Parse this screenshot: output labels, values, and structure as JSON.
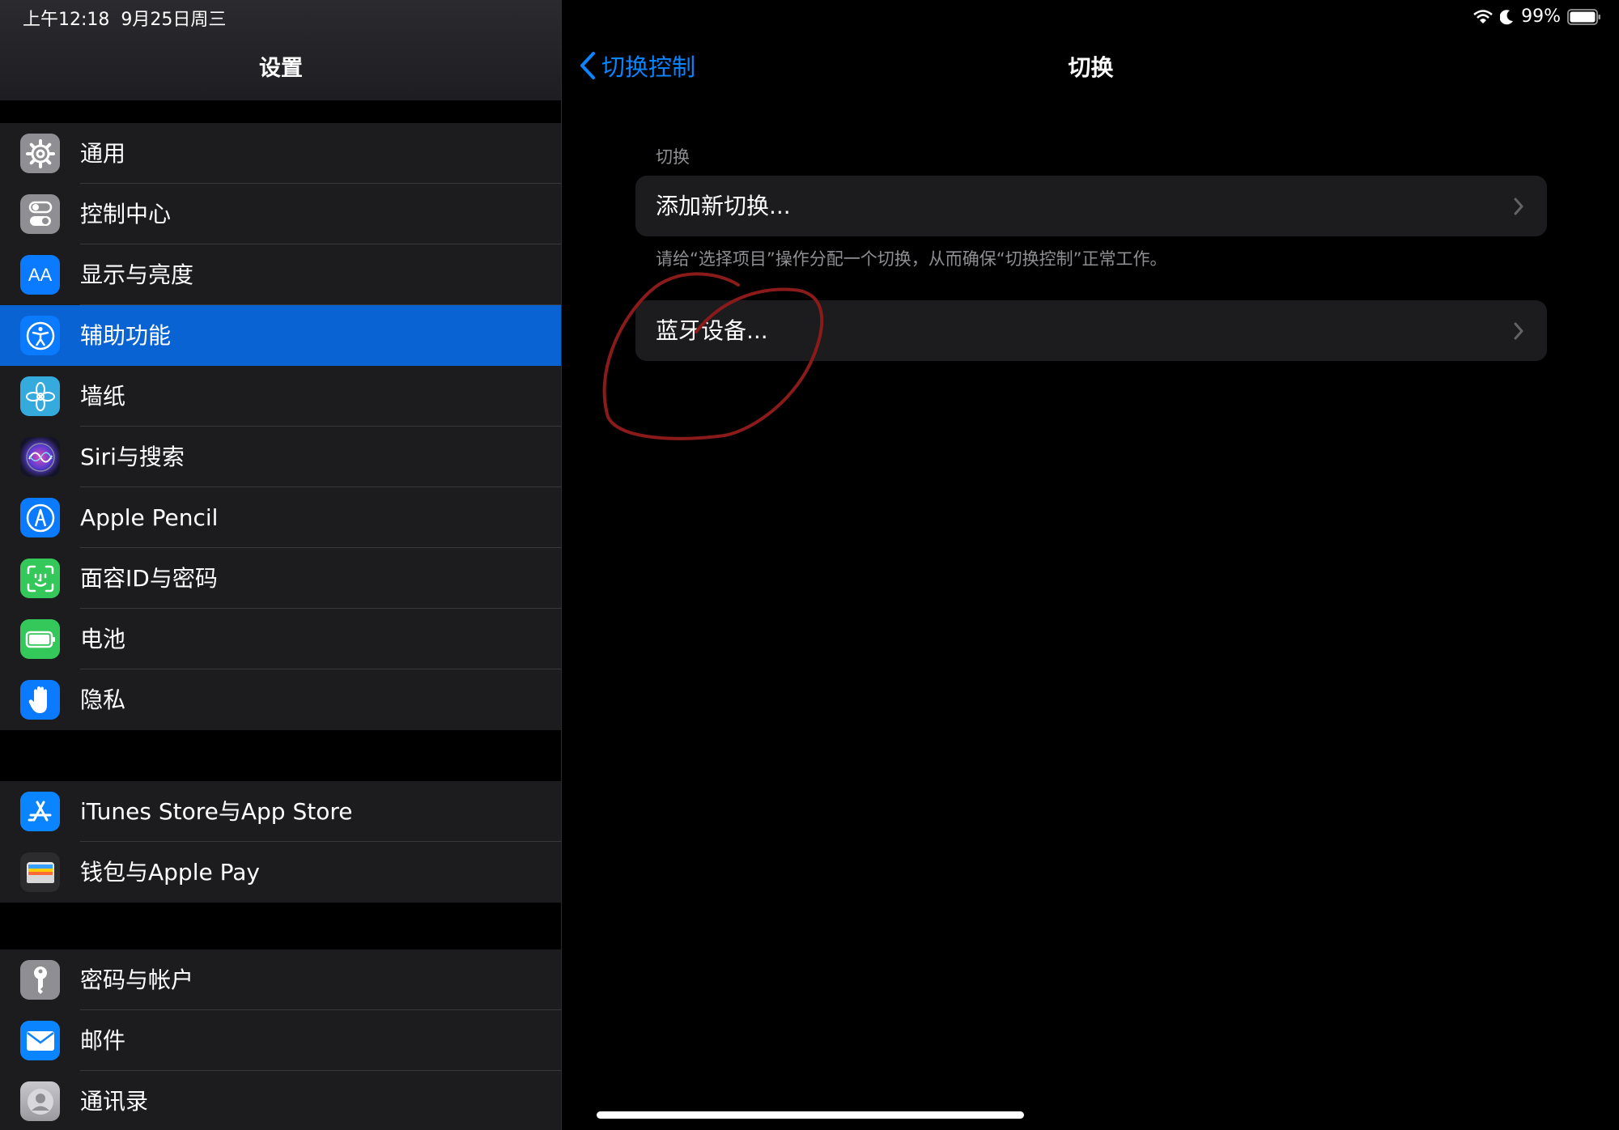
{
  "status_bar": {
    "time": "上午12:18",
    "date": "9月25日周三",
    "battery": "99%"
  },
  "sidebar": {
    "title": "设置",
    "groups": [
      {
        "items": [
          {
            "label": "通用",
            "icon": "gear-icon",
            "color": "#8e8e93"
          },
          {
            "label": "控制中心",
            "icon": "toggle-icon",
            "color": "#8e8e93"
          },
          {
            "label": "显示与亮度",
            "icon": "text-size-icon",
            "color": "#0a7aff"
          },
          {
            "label": "辅助功能",
            "icon": "accessibility-icon",
            "color": "#0a7aff",
            "selected": true
          },
          {
            "label": "墙纸",
            "icon": "flower-icon",
            "color": "#35aadc"
          },
          {
            "label": "Siri与搜索",
            "icon": "siri-icon",
            "color": "#1a1a2e"
          },
          {
            "label": "Apple Pencil",
            "icon": "pencil-icon",
            "color": "#0a7aff"
          },
          {
            "label": "面容ID与密码",
            "icon": "face-id-icon",
            "color": "#34c759"
          },
          {
            "label": "电池",
            "icon": "battery-icon",
            "color": "#34c759"
          },
          {
            "label": "隐私",
            "icon": "hand-icon",
            "color": "#0a7aff"
          }
        ]
      },
      {
        "items": [
          {
            "label": "iTunes Store与App Store",
            "icon": "app-store-icon",
            "color": "#0a84ff"
          },
          {
            "label": "钱包与Apple Pay",
            "icon": "wallet-icon",
            "color": "#2c2c2e"
          }
        ]
      },
      {
        "items": [
          {
            "label": "密码与帐户",
            "icon": "key-icon",
            "color": "#8e8e93"
          },
          {
            "label": "邮件",
            "icon": "mail-icon",
            "color": "#0a84ff"
          },
          {
            "label": "通讯录",
            "icon": "contacts-icon",
            "color": "#9a9a9e"
          }
        ]
      }
    ]
  },
  "detail": {
    "back_label": "切换控制",
    "title": "切换",
    "section_header": "切换",
    "add_switch_label": "添加新切换...",
    "footer_note": "请给“选择项目”操作分配一个切换，从而确保“切换控制”正常工作。",
    "bluetooth_label": "蓝牙设备..."
  },
  "colors": {
    "accent": "#0a84ff",
    "selected_row": "#0a63d2",
    "annotation": "#8b1a1a"
  }
}
